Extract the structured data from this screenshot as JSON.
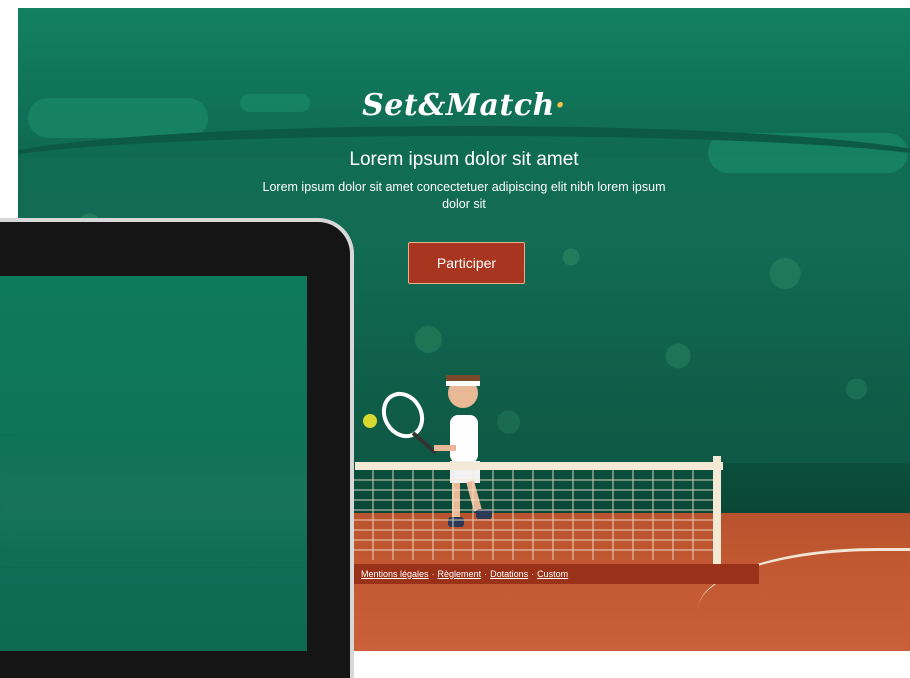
{
  "brand": {
    "name": "Set&Match",
    "dot": "·"
  },
  "hero": {
    "headline": "Lorem ipsum dolor sit amet",
    "subline": "Lorem ipsum dolor sit amet concectetuer adipiscing elit nibh lorem ipsum dolor sit",
    "cta_label": "Participer"
  },
  "footer": {
    "links": [
      {
        "label": "Mentions légales"
      },
      {
        "label": "Règlement"
      },
      {
        "label": "Dotations"
      },
      {
        "label": "Custom"
      }
    ],
    "separator": "·"
  },
  "colors": {
    "background_green": "#0f6b52",
    "court_clay": "#c45a33",
    "cta": "#a7351f",
    "accent_dot": "#f3c444"
  }
}
